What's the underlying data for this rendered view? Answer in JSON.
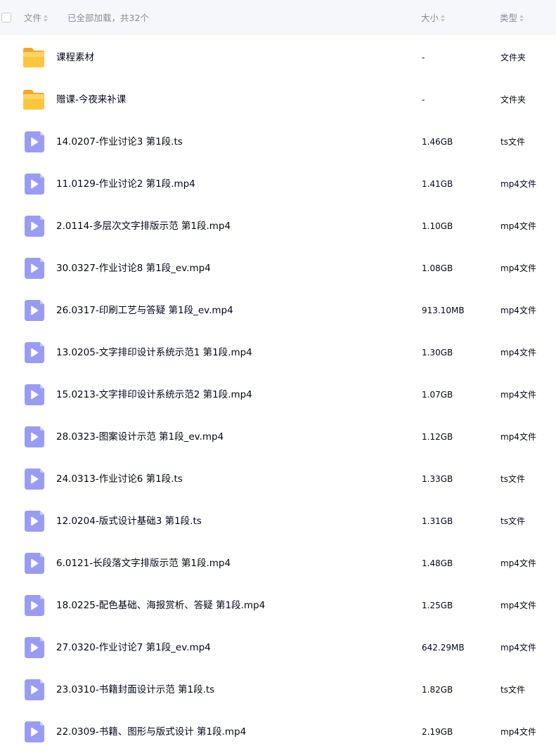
{
  "header": {
    "name_label": "文件",
    "loaded_text": "已全部加载，共32个",
    "size_label": "大小",
    "type_label": "类型"
  },
  "colors": {
    "folder": "#ffc53d",
    "video_icon": "#9a9cf4",
    "header_bg": "#f6f7fa"
  },
  "files": [
    {
      "icon": "folder-icon",
      "name": "课程素材",
      "size": "-",
      "type": "文件夹"
    },
    {
      "icon": "folder-icon",
      "name": "赠课-今夜来补课",
      "size": "-",
      "type": "文件夹"
    },
    {
      "icon": "video-icon",
      "name": "14.0207-作业讨论3 第1段.ts",
      "size": "1.46GB",
      "type": "ts文件"
    },
    {
      "icon": "video-icon",
      "name": "11.0129-作业讨论2 第1段.mp4",
      "size": "1.41GB",
      "type": "mp4文件"
    },
    {
      "icon": "video-icon",
      "name": "2.0114-多层次文字排版示范 第1段.mp4",
      "size": "1.10GB",
      "type": "mp4文件"
    },
    {
      "icon": "video-icon",
      "name": "30.0327-作业讨论8 第1段_ev.mp4",
      "size": "1.08GB",
      "type": "mp4文件"
    },
    {
      "icon": "video-icon",
      "name": "26.0317-印刷工艺与答疑 第1段_ev.mp4",
      "size": "913.10MB",
      "type": "mp4文件"
    },
    {
      "icon": "video-icon",
      "name": "13.0205-文字排印设计系统示范1 第1段.mp4",
      "size": "1.30GB",
      "type": "mp4文件"
    },
    {
      "icon": "video-icon",
      "name": "15.0213-文字排印设计系统示范2 第1段.mp4",
      "size": "1.07GB",
      "type": "mp4文件"
    },
    {
      "icon": "video-icon",
      "name": "28.0323-图案设计示范 第1段_ev.mp4",
      "size": "1.12GB",
      "type": "mp4文件"
    },
    {
      "icon": "video-icon",
      "name": "24.0313-作业讨论6 第1段.ts",
      "size": "1.33GB",
      "type": "ts文件"
    },
    {
      "icon": "video-icon",
      "name": "12.0204-版式设计基础3 第1段.ts",
      "size": "1.31GB",
      "type": "ts文件"
    },
    {
      "icon": "video-icon",
      "name": "6.0121-长段落文字排版示范 第1段.mp4",
      "size": "1.48GB",
      "type": "mp4文件"
    },
    {
      "icon": "video-icon",
      "name": "18.0225-配色基础、海报赏析、答疑 第1段.mp4",
      "size": "1.25GB",
      "type": "mp4文件"
    },
    {
      "icon": "video-icon",
      "name": "27.0320-作业讨论7 第1段_ev.mp4",
      "size": "642.29MB",
      "type": "mp4文件"
    },
    {
      "icon": "video-icon",
      "name": "23.0310-书籍封面设计示范 第1段.ts",
      "size": "1.82GB",
      "type": "ts文件"
    },
    {
      "icon": "video-icon",
      "name": "22.0309-书籍、图形与版式设计 第1段.mp4",
      "size": "2.19GB",
      "type": "mp4文件"
    }
  ]
}
